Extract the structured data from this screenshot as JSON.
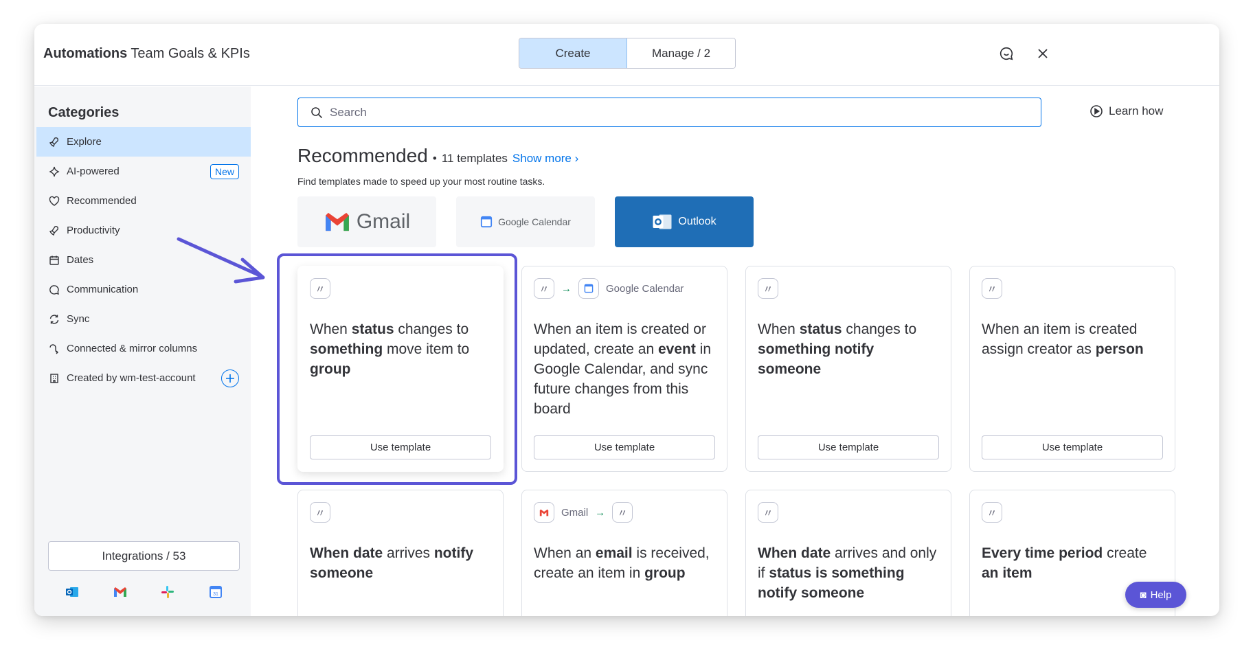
{
  "header": {
    "title_bold": "Automations",
    "title_rest": " Team Goals & KPIs",
    "tabs": [
      {
        "label": "Create",
        "active": true
      },
      {
        "label": "Manage / 2",
        "active": false
      }
    ]
  },
  "sidebar": {
    "heading": "Categories",
    "items": [
      {
        "label": "Explore",
        "icon": "rocket-icon"
      },
      {
        "label": "AI-powered",
        "icon": "sparkle-icon",
        "badge": "New"
      },
      {
        "label": "Recommended",
        "icon": "heart-icon"
      },
      {
        "label": "Productivity",
        "icon": "rocket-icon"
      },
      {
        "label": "Dates",
        "icon": "calendar-icon"
      },
      {
        "label": "Communication",
        "icon": "chat-icon"
      },
      {
        "label": "Sync",
        "icon": "sync-icon"
      },
      {
        "label": "Connected & mirror columns",
        "icon": "connect-icon"
      },
      {
        "label": "Created by wm-test-account",
        "icon": "building-icon"
      }
    ],
    "integrations_label": "Integrations / 53",
    "integration_apps": [
      "outlook-icon",
      "gmail-icon",
      "slack-icon",
      "google-calendar-icon"
    ]
  },
  "search": {
    "placeholder": "Search"
  },
  "learn_how": "Learn how",
  "recommended": {
    "title": "Recommended",
    "count": "11 templates",
    "show_more": "Show more",
    "subtitle": "Find templates made to speed up your most routine tasks."
  },
  "app_tabs": [
    {
      "label": "Gmail",
      "icon": "gmail-icon"
    },
    {
      "label": "Google Calendar",
      "icon": "google-calendar-icon"
    },
    {
      "label": "Outlook",
      "icon": "outlook-icon",
      "active": true
    }
  ],
  "use_template_label": "Use template",
  "cards_row1": {
    "c1": {
      "p1": "When ",
      "b1": "status",
      "p2": " changes to ",
      "b2": "something",
      "p3": " move item to ",
      "b3": "group"
    },
    "c2": {
      "app": "Google Calendar",
      "p1": "When an item is created or updated, create an ",
      "b1": "event",
      "p2": " in Google Calendar, and sync future changes from this board"
    },
    "c3": {
      "p1": "When ",
      "b1": "status",
      "p2": " changes to ",
      "b2": "something notify someone"
    },
    "c4": {
      "p1": "When an item is created assign creator as ",
      "b1": "person"
    }
  },
  "cards_row2": {
    "c1": {
      "b1": "When date",
      "p1": " arrives ",
      "b2": "notify someone"
    },
    "c2": {
      "app": "Gmail",
      "p1": "When an ",
      "b1": "email",
      "p2": " is received, create an item in ",
      "b2": "group"
    },
    "c3": {
      "b1": "When date",
      "p1": " arrives and only if ",
      "b2": "status is something notify someone"
    },
    "c4": {
      "b1": "Every time period",
      "p1": " create ",
      "b2": "an item"
    }
  },
  "help_label": "Help",
  "colors": {
    "accent": "#0073ea",
    "highlight": "#5b55d6",
    "outlook": "#1f6eb6"
  }
}
